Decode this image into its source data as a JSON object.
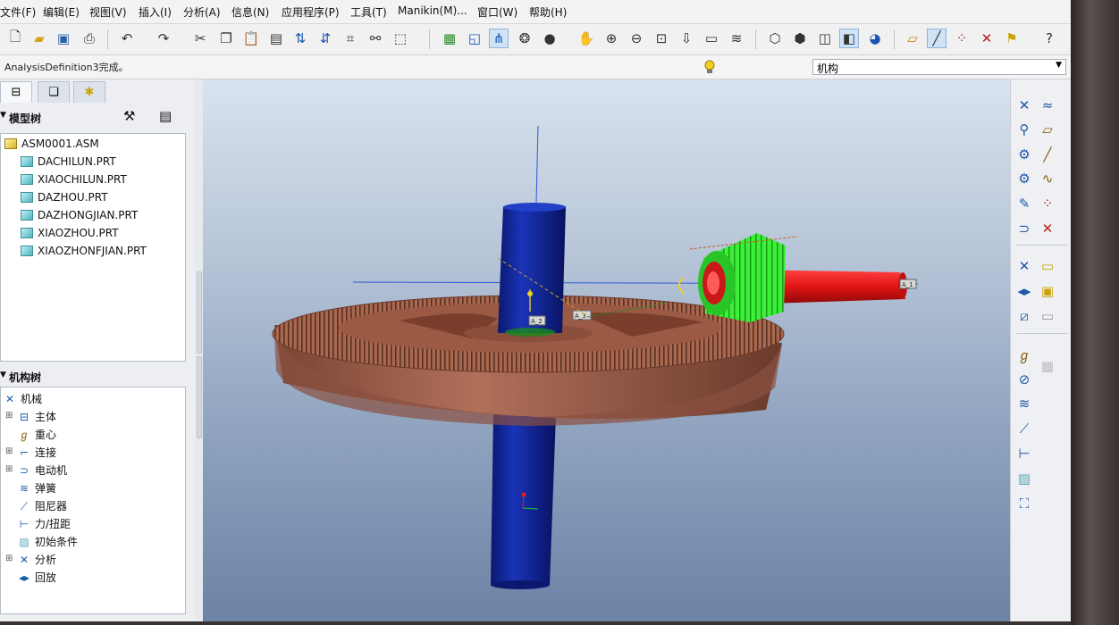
{
  "menu": [
    "文件(F)",
    "编辑(E)",
    "视图(V)",
    "插入(I)",
    "分析(A)",
    "信息(N)",
    "应用程序(P)",
    "工具(T)",
    "Manikin(M)...",
    "窗口(W)",
    "帮助(H)"
  ],
  "toolbar_icons": [
    "new-file-icon",
    "open-folder-icon",
    "save-icon",
    "print-icon",
    "undo-icon",
    "redo-icon",
    "cut-icon",
    "copy-icon",
    "paste-icon",
    "paste-special-icon",
    "regenerate-icon",
    "regenerate-manager-icon",
    "find-icon",
    "binoculars-icon",
    "select-box-icon",
    "repaint-icon",
    "orient-icon",
    "spin-center-icon",
    "layers-icon",
    "sphere-icon",
    "pan-icon",
    "zoom-in-icon",
    "zoom-out-icon",
    "refit-icon",
    "saved-view-icon",
    "named-view-icon",
    "layer-stack-icon",
    "wireframe-icon",
    "hidden-line-icon",
    "no-hidden-icon",
    "shading-icon",
    "enhanced-realism-icon",
    "datum-plane-icon",
    "datum-axis-icon",
    "datum-point-icon",
    "coord-sys-icon",
    "annotation-icon",
    "context-help-icon"
  ],
  "status": {
    "message": "AnalysisDefinition3完成。",
    "filter_value": "机构"
  },
  "tabs": [
    "model-tree-tab",
    "layer-tree-tab",
    "favorites-tab"
  ],
  "model_tree": {
    "header": "模型树",
    "root": "ASM0001.ASM",
    "items": [
      "DACHILUN.PRT",
      "XIAOCHILUN.PRT",
      "DAZHOU.PRT",
      "DAZHONGJIAN.PRT",
      "XIAOZHOU.PRT",
      "XIAOZHONFJIAN.PRT"
    ]
  },
  "mech_tree": {
    "header": "机构树",
    "root": "机械",
    "items": [
      {
        "label": "主体",
        "expandable": true,
        "icon": "body-icon"
      },
      {
        "label": "重心",
        "expandable": false,
        "icon": "gravity-icon"
      },
      {
        "label": "连接",
        "expandable": true,
        "icon": "connection-icon"
      },
      {
        "label": "电动机",
        "expandable": true,
        "icon": "motor-icon"
      },
      {
        "label": "弹簧",
        "expandable": false,
        "icon": "spring-icon"
      },
      {
        "label": "阻尼器",
        "expandable": false,
        "icon": "damper-icon"
      },
      {
        "label": "力/扭距",
        "expandable": false,
        "icon": "force-torque-icon"
      },
      {
        "label": "初始条件",
        "expandable": false,
        "icon": "initial-condition-icon"
      },
      {
        "label": "分析",
        "expandable": true,
        "icon": "analysis-icon"
      },
      {
        "label": "回放",
        "expandable": false,
        "icon": "playback-icon"
      }
    ]
  },
  "viewport_labels": {
    "axis_1": "A_1",
    "axis_2": "A_2",
    "axis_3": "A_3"
  },
  "right_tools": [
    "servo-motor-icon",
    "cam-icon",
    "gravity-tool-icon",
    "slot-icon",
    "gear-pair-icon",
    "belt-icon",
    "connect-icon",
    "curve-icon",
    "drag-icon",
    "point-icon",
    "spring-tool-icon",
    "cross-icon",
    "analysis-tool-icon",
    "note-icon",
    "playback-tool-icon",
    "measure-icon",
    "graph-icon",
    "trace-icon",
    "mass-icon",
    "table-icon",
    "force-icon",
    "spring2-icon",
    "damper-tool-icon",
    "torque-icon",
    "initial-icon",
    "bearing-icon"
  ],
  "colors": {
    "big_gear": "#a0634a",
    "small_gear": "#2fe82a",
    "shaft_big": "#0d1e8a",
    "shaft_small": "#e01414"
  }
}
